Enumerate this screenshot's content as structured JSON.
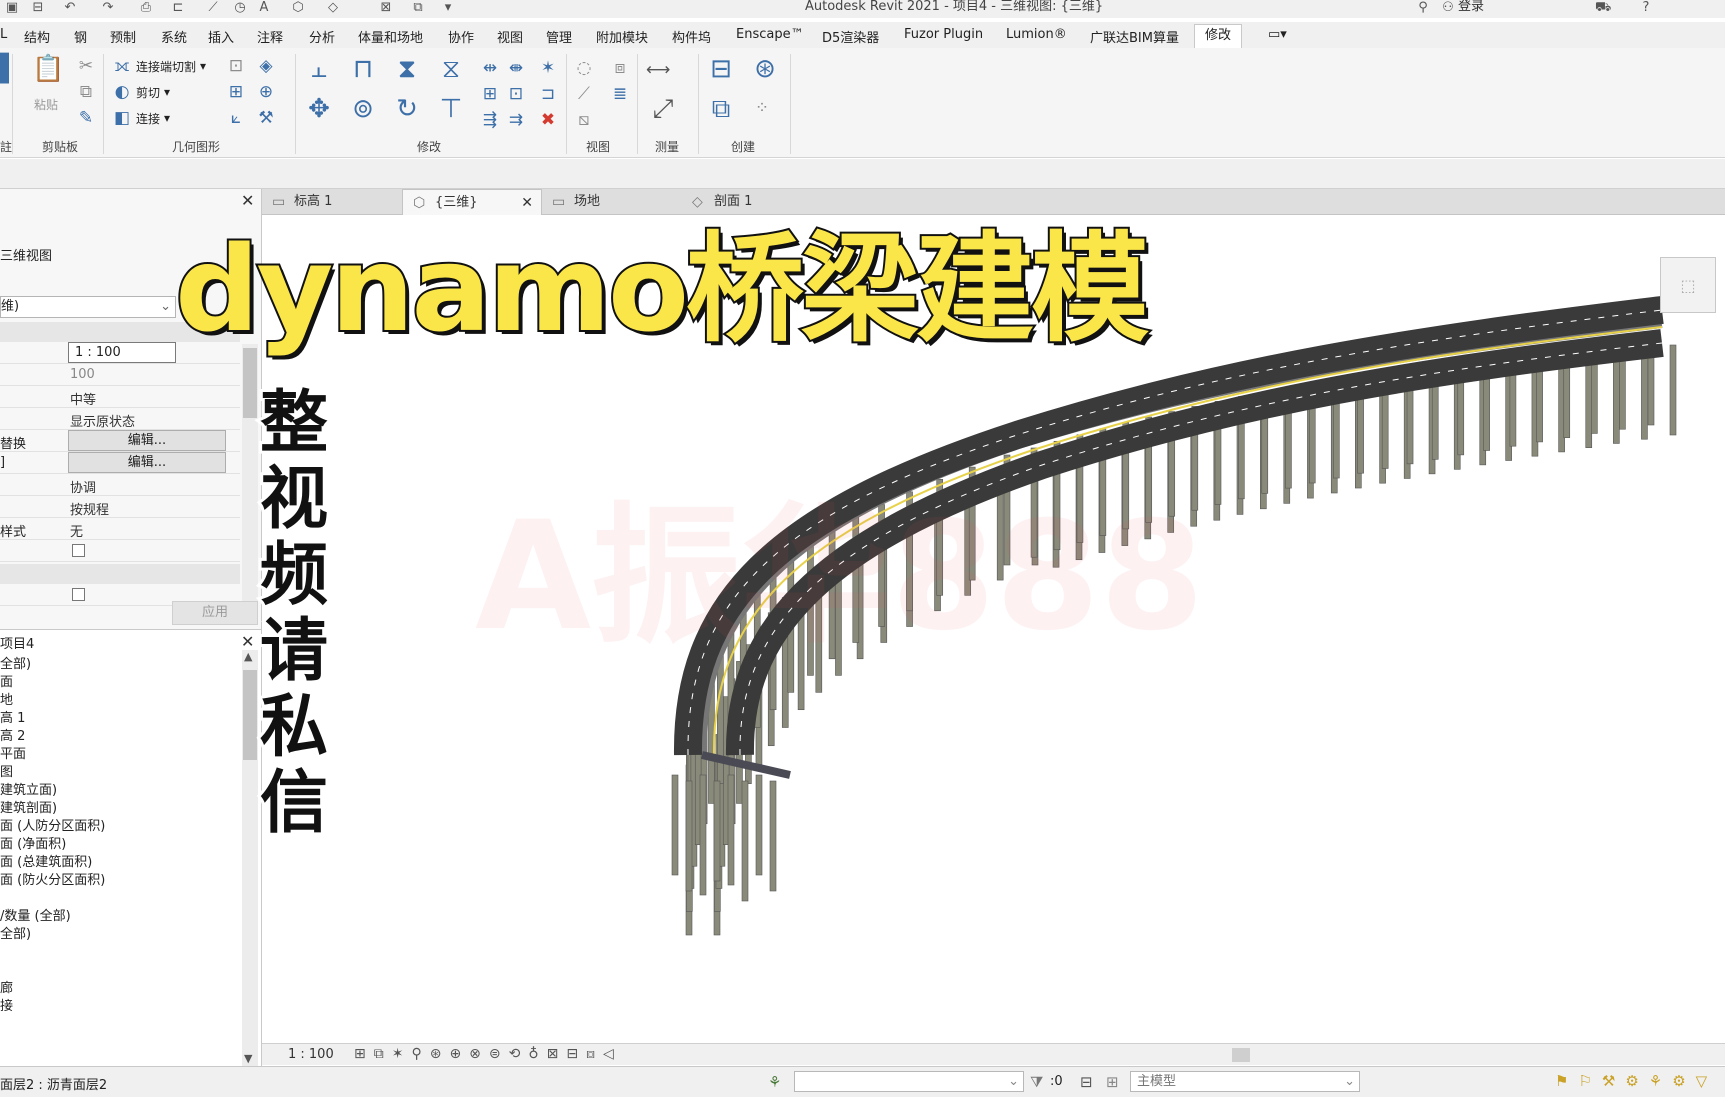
{
  "window": {
    "title": "Autodesk Revit 2021 - 项目4 - 三维视图: {三维}",
    "login": "登录"
  },
  "ribbon_tabs": [
    {
      "label": "结构"
    },
    {
      "label": "钢"
    },
    {
      "label": "预制"
    },
    {
      "label": "系统"
    },
    {
      "label": "插入"
    },
    {
      "label": "注释"
    },
    {
      "label": "分析"
    },
    {
      "label": "体量和场地"
    },
    {
      "label": "协作"
    },
    {
      "label": "视图"
    },
    {
      "label": "管理"
    },
    {
      "label": "附加模块"
    },
    {
      "label": "构件坞"
    },
    {
      "label": "Enscape™"
    },
    {
      "label": "D5渲染器"
    },
    {
      "label": "Fuzor Plugin"
    },
    {
      "label": "Lumion®"
    },
    {
      "label": "广联达BIM算量"
    },
    {
      "label": "修改"
    }
  ],
  "ribbon": {
    "paste_label": "粘贴",
    "connect_cut_label": "连接端切割",
    "cut_label": "剪切",
    "join_label": "连接",
    "panels": {
      "clipboard": "剪贴板",
      "geometry": "几何图形",
      "modify": "修改",
      "view": "视图",
      "measure": "测量",
      "create": "创建"
    },
    "left_cut_label": "註"
  },
  "properties": {
    "type_label": "三维视图",
    "type_selector": "维)",
    "rows": [
      {
        "key": "",
        "value": "1 : 100"
      },
      {
        "key": "",
        "value": "100"
      },
      {
        "key": "",
        "value": "中等"
      },
      {
        "key": "",
        "value": "显示原状态"
      },
      {
        "key": "替换",
        "value": "编辑..."
      },
      {
        "key": "]",
        "value": "编辑..."
      },
      {
        "key": "",
        "value": "协调"
      },
      {
        "key": "",
        "value": "按规程"
      },
      {
        "key": "样式",
        "value": "无"
      }
    ],
    "apply_label": "应用"
  },
  "browser": {
    "root": "项目4",
    "items": [
      "全部)",
      "面",
      "地",
      "高 1",
      "高 2",
      "平面",
      "图",
      "建筑立面)",
      "建筑剖面)",
      "面 (人防分区面积)",
      "面 (净面积)",
      "面 (总建筑面积)",
      "面 (防火分区面积)",
      "",
      "/数量 (全部)",
      "全部)",
      "",
      "",
      "廊",
      "接"
    ]
  },
  "view_tabs": [
    {
      "label": "标高 1",
      "active": false
    },
    {
      "label": "{三维}",
      "active": true
    },
    {
      "label": "场地",
      "active": false
    },
    {
      "label": "剖面 1",
      "active": false
    }
  ],
  "view_bar": {
    "scale": "1 : 100"
  },
  "status": {
    "text": "面层2 : 沥青面层2",
    "selection_count": ":0",
    "model_field": "主模型"
  },
  "overlay": {
    "title": "dynamo桥梁建模",
    "side_text": "整视频请私信",
    "watermark": "A振华888"
  },
  "colors": {
    "title_fill": "#fbe64a",
    "road": "#3a3a3a",
    "pier": "#8a8a7a",
    "lane_marking": "#e8d24a"
  }
}
